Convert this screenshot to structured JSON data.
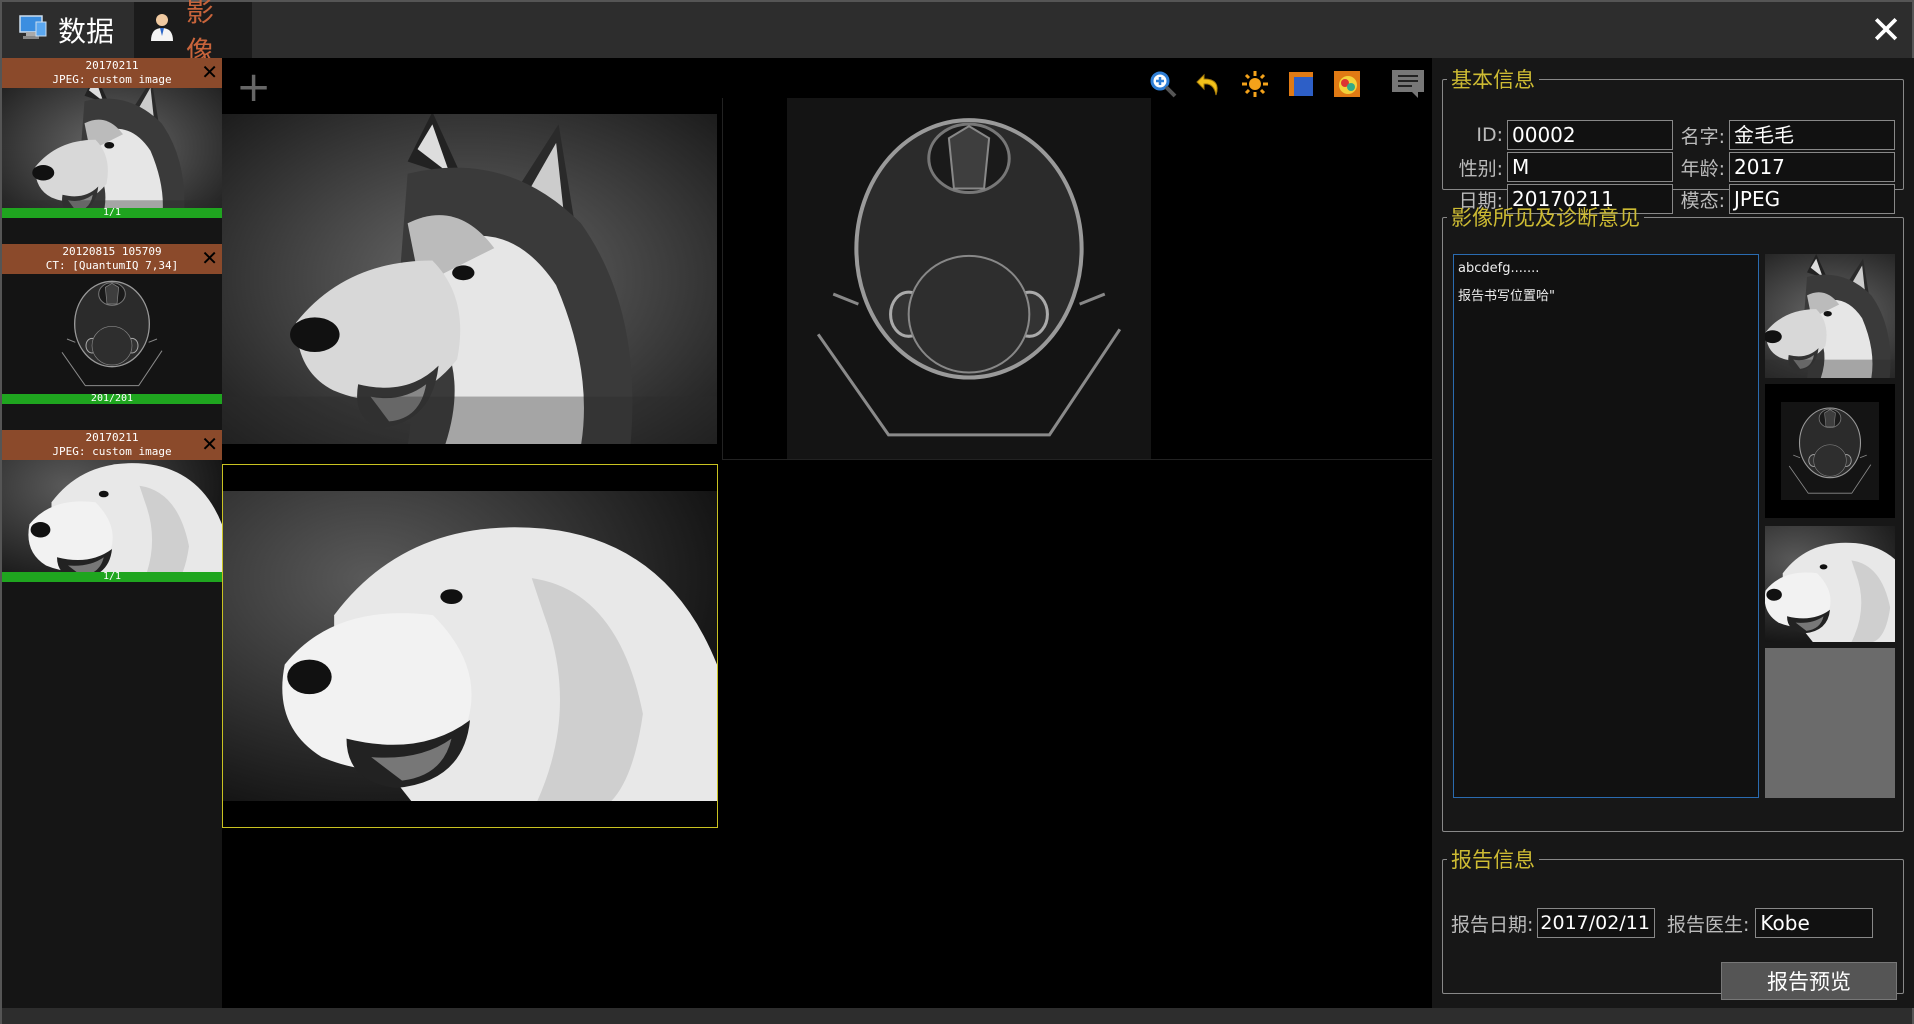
{
  "tabs": [
    {
      "label": "数据",
      "icon": "monitor-icon"
    },
    {
      "label": "影像",
      "icon": "doctor-icon"
    }
  ],
  "series": [
    {
      "line1": "20170211",
      "line2": "JPEG: custom image",
      "count": "1/1",
      "subject": "husky"
    },
    {
      "line1": "20120815 105709",
      "line2": "CT: [QuantumIQ 7,34]",
      "count": "201/201",
      "subject": "ct"
    },
    {
      "line1": "20170211",
      "line2": "JPEG: custom image",
      "count": "1/1",
      "subject": "golden"
    }
  ],
  "toolbar": [
    "zoom-icon",
    "undo-icon",
    "brightness-icon",
    "window-icon",
    "color-icon"
  ],
  "basic_info": {
    "legend": "基本信息",
    "id_label": "ID:",
    "id_value": "00002",
    "name_label": "名字:",
    "name_value": "金毛毛",
    "sex_label": "性别:",
    "sex_value": "M",
    "age_label": "年龄:",
    "age_value": "2017",
    "date_label": "日期:",
    "date_value": "20170211",
    "modality_label": "模态:",
    "modality_value": "JPEG"
  },
  "findings": {
    "legend": "影像所见及诊断意见",
    "text_line1": "abcdefg.......",
    "text_line2": "报告书写位置哈\""
  },
  "report_info": {
    "legend": "报告信息",
    "date_label": "报告日期:",
    "date_value": "2017/02/11",
    "doctor_label": "报告医生:",
    "doctor_value": "Kobe",
    "preview_button": "报告预览"
  },
  "colors": {
    "accent": "#cdbb33",
    "series_header": "#8b4a2b",
    "progress": "#1fa51f",
    "active_tab_text": "#c8643b"
  }
}
